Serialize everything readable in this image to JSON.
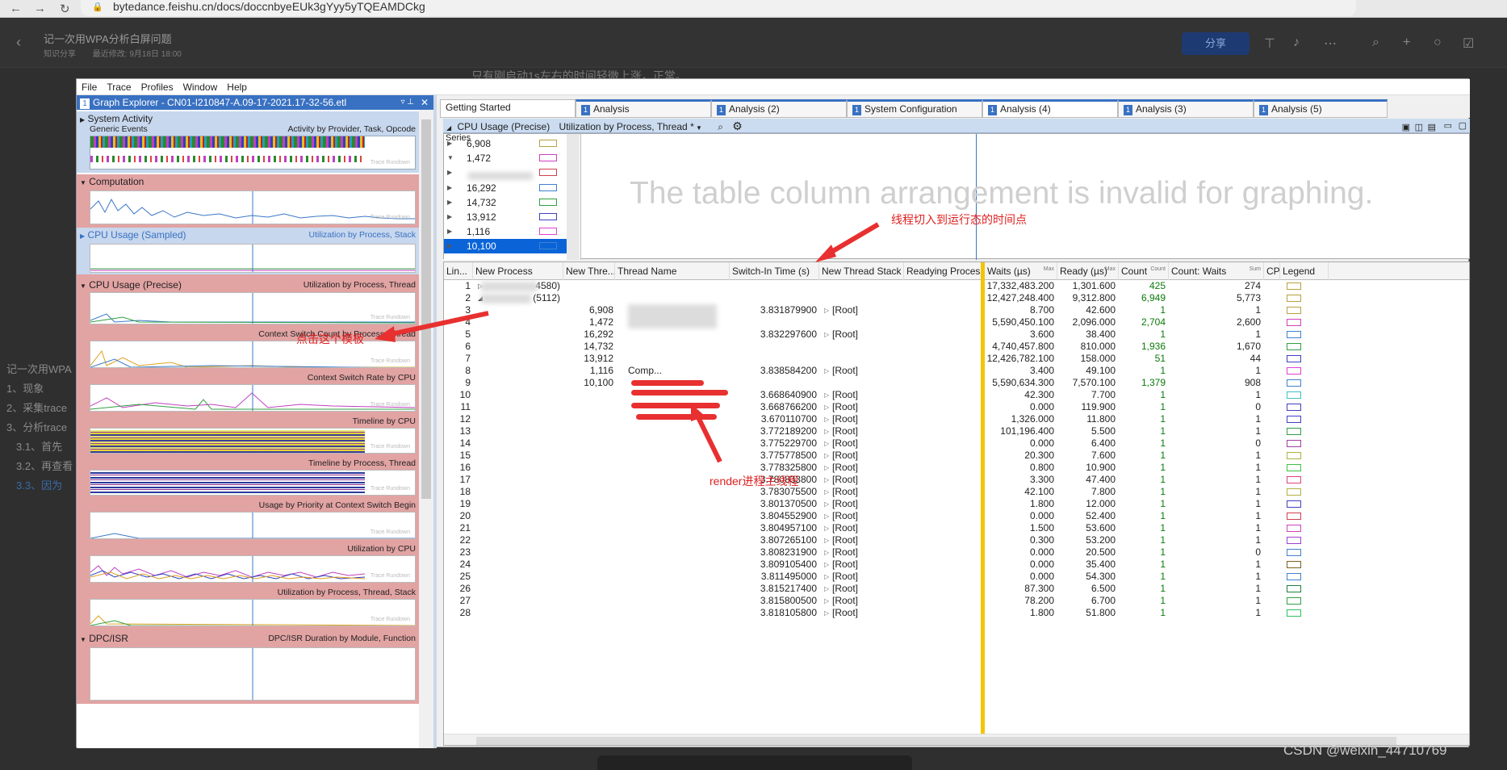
{
  "browser": {
    "url": "bytedance.feishu.cn/docs/doccnbyeEUk3gYyy5yTQEAMDCkg"
  },
  "doc": {
    "title": "记一次用WPA分析白屏问题",
    "meta_tag": "知识分享",
    "meta_updated": "最近修改: 9月18日 18:00",
    "share_label": "分享",
    "sentence": "只有刚启动1s左右的时间轻微上涨，正常。",
    "toc": [
      "记一次用WPA",
      "1、现象",
      "2、采集trace",
      "3、分析trace",
      "3.1、首先",
      "3.2、再查看",
      "3.3、因为"
    ]
  },
  "wpa": {
    "menu": [
      "File",
      "Trace",
      "Profiles",
      "Window",
      "Help"
    ],
    "graph_explorer": {
      "number": "1",
      "title": "Graph Explorer - CN01-I210847-A.09-17-2021.17-32-56.etl",
      "groups": [
        {
          "name": "System Activity",
          "sub": "Generic Events",
          "label": "Activity by Provider, Task, Opcode"
        },
        {
          "name": "Computation",
          "label": ""
        },
        {
          "name": "CPU Usage (Sampled)",
          "label": "Utilization by Process, Stack"
        },
        {
          "name": "CPU Usage (Precise)",
          "label": "Utilization by Process, Thread"
        }
      ],
      "graphs": [
        "Context Switch Count by Process, Thread",
        "Context Switch Rate by CPU",
        "Timeline by CPU",
        "Timeline by Process, Thread",
        "Usage by Priority at Context Switch Begin",
        "Utilization by CPU",
        "Utilization by Process, Thread, Stack"
      ],
      "dpc_group": {
        "name": "DPC/ISR",
        "label": "DPC/ISR Duration by Module, Function"
      },
      "watermark": "Trace Rundown"
    },
    "tabs": [
      {
        "num": "",
        "label": "Getting Started"
      },
      {
        "num": "1",
        "label": "Analysis"
      },
      {
        "num": "1",
        "label": "Analysis (2)"
      },
      {
        "num": "1",
        "label": "System Configuration"
      },
      {
        "num": "1",
        "label": "Analysis (4)"
      },
      {
        "num": "1",
        "label": "Analysis (3)"
      },
      {
        "num": "1",
        "label": "Analysis (5)"
      }
    ],
    "view": {
      "title": "CPU Usage (Precise)",
      "preset": "Utilization by Process, Thread *"
    },
    "series": {
      "header": "Series",
      "rows": [
        {
          "val": "6,908",
          "color": "#b8a040",
          "expanded": false
        },
        {
          "val": "1,472",
          "color": "#d040c0",
          "expanded": true
        },
        {
          "val": "",
          "color": "#d04050",
          "expanded": false
        },
        {
          "val": "16,292",
          "color": "#4080d0",
          "expanded": false
        },
        {
          "val": "14,732",
          "color": "#30a040",
          "expanded": false
        },
        {
          "val": "13,912",
          "color": "#4040c0",
          "expanded": false
        },
        {
          "val": "1,116",
          "color": "#e040d0",
          "expanded": false
        },
        {
          "val": "10,100",
          "color": "#4080d0",
          "expanded": false,
          "selected": true
        }
      ]
    },
    "graph_message": "The table column arrangement is invalid for graphing.",
    "columns": [
      {
        "label": "Lin...",
        "sub": ""
      },
      {
        "label": "New Process",
        "sub": ""
      },
      {
        "label": "New Thre...",
        "sub": ""
      },
      {
        "label": "Thread Name",
        "sub": ""
      },
      {
        "label": "Switch-In Time (s)",
        "sub": ""
      },
      {
        "label": "New Thread Stack",
        "sub": ""
      },
      {
        "label": "Readying Process",
        "sub": ""
      },
      {
        "label": "Waits (µs)",
        "sub": "Max"
      },
      {
        "label": "Ready (µs)",
        "sub": "Max"
      },
      {
        "label": "Count",
        "sub": "Count"
      },
      {
        "label": "Count: Waits",
        "sub": "Sum"
      },
      {
        "label": "CPU",
        "sub": ""
      },
      {
        "label": "Legend",
        "sub": ""
      }
    ],
    "rows": [
      {
        "line": "1",
        "proc": "4580)",
        "thread": "",
        "name": "",
        "switch": "",
        "stack": "",
        "waits": "17,332,483.200",
        "ready": "1,301.600",
        "count": "425",
        "cw": "274",
        "color": "#b8a040"
      },
      {
        "line": "2",
        "proc": "(5112)",
        "thread": "",
        "name": "",
        "switch": "",
        "stack": "",
        "waits": "12,427,248.400",
        "ready": "9,312.800",
        "count": "6,949",
        "cw": "5,773",
        "color": "#b8a040"
      },
      {
        "line": "3",
        "proc": "",
        "thread": "6,908",
        "name": "",
        "switch": "3.831879900",
        "stack": "[Root]",
        "waits": "8.700",
        "ready": "42.600",
        "count": "1",
        "cw": "1",
        "color": "#b8a040"
      },
      {
        "line": "4",
        "proc": "",
        "thread": "1,472",
        "name": "",
        "switch": "",
        "stack": "",
        "waits": "5,590,450.100",
        "ready": "2,096.000",
        "count": "2,704",
        "cw": "2,600",
        "color": "#d040c0"
      },
      {
        "line": "5",
        "proc": "",
        "thread": "16,292",
        "name": "",
        "switch": "3.832297600",
        "stack": "[Root]",
        "waits": "3.600",
        "ready": "38.400",
        "count": "1",
        "cw": "1",
        "color": "#4080d0"
      },
      {
        "line": "6",
        "proc": "",
        "thread": "14,732",
        "name": "",
        "switch": "",
        "stack": "",
        "waits": "4,740,457.800",
        "ready": "810.000",
        "count": "1,936",
        "cw": "1,670",
        "color": "#30a040"
      },
      {
        "line": "7",
        "proc": "",
        "thread": "13,912",
        "name": "",
        "switch": "",
        "stack": "",
        "waits": "12,426,782.100",
        "ready": "158.000",
        "count": "51",
        "cw": "44",
        "color": "#4040c0"
      },
      {
        "line": "8",
        "proc": "",
        "thread": "1,116",
        "name": "Comp...",
        "switch": "3.838584200",
        "stack": "[Root]",
        "waits": "3.400",
        "ready": "49.100",
        "count": "1",
        "cw": "1",
        "color": "#e040d0"
      },
      {
        "line": "9",
        "proc": "",
        "thread": "10,100",
        "name": "",
        "switch": "",
        "stack": "",
        "waits": "5,590,634.300",
        "ready": "7,570.100",
        "count": "1,379",
        "cw": "908",
        "color": "#4080d0"
      },
      {
        "line": "10",
        "proc": "",
        "thread": "",
        "name": "",
        "switch": "3.668640900",
        "stack": "[Root]",
        "waits": "42.300",
        "ready": "7.700",
        "count": "1",
        "cw": "1",
        "color": "#40c0c0"
      },
      {
        "line": "11",
        "proc": "",
        "thread": "",
        "name": "",
        "switch": "3.668766200",
        "stack": "[Root]",
        "waits": "0.000",
        "ready": "119.900",
        "count": "1",
        "cw": "0",
        "color": "#4040c0"
      },
      {
        "line": "12",
        "proc": "",
        "thread": "",
        "name": "",
        "switch": "3.670110700",
        "stack": "[Root]",
        "waits": "1,326.000",
        "ready": "11.800",
        "count": "1",
        "cw": "1",
        "color": "#4040c0"
      },
      {
        "line": "13",
        "proc": "",
        "thread": "",
        "name": "",
        "switch": "3.772189200",
        "stack": "[Root]",
        "waits": "101,196.400",
        "ready": "5.500",
        "count": "1",
        "cw": "1",
        "color": "#30a040"
      },
      {
        "line": "14",
        "proc": "",
        "thread": "",
        "name": "",
        "switch": "3.775229700",
        "stack": "[Root]",
        "waits": "0.000",
        "ready": "6.400",
        "count": "1",
        "cw": "0",
        "color": "#a040a0"
      },
      {
        "line": "15",
        "proc": "",
        "thread": "",
        "name": "",
        "switch": "3.775778500",
        "stack": "[Root]",
        "waits": "20.300",
        "ready": "7.600",
        "count": "1",
        "cw": "1",
        "color": "#b0b040"
      },
      {
        "line": "16",
        "proc": "",
        "thread": "",
        "name": "",
        "switch": "3.778325800",
        "stack": "[Root]",
        "waits": "0.800",
        "ready": "10.900",
        "count": "1",
        "cw": "1",
        "color": "#40c040"
      },
      {
        "line": "17",
        "proc": "",
        "thread": "",
        "name": "",
        "switch": "3.780833800",
        "stack": "[Root]",
        "waits": "3.300",
        "ready": "47.400",
        "count": "1",
        "cw": "1",
        "color": "#e04080"
      },
      {
        "line": "18",
        "proc": "",
        "thread": "",
        "name": "",
        "switch": "3.783075500",
        "stack": "[Root]",
        "waits": "42.100",
        "ready": "7.800",
        "count": "1",
        "cw": "1",
        "color": "#b0b040"
      },
      {
        "line": "19",
        "proc": "",
        "thread": "",
        "name": "",
        "switch": "3.801370500",
        "stack": "[Root]",
        "waits": "1.800",
        "ready": "12.000",
        "count": "1",
        "cw": "1",
        "color": "#4040c0"
      },
      {
        "line": "20",
        "proc": "",
        "thread": "",
        "name": "",
        "switch": "3.804552900",
        "stack": "[Root]",
        "waits": "0.000",
        "ready": "52.400",
        "count": "1",
        "cw": "1",
        "color": "#d04050"
      },
      {
        "line": "21",
        "proc": "",
        "thread": "",
        "name": "",
        "switch": "3.804957100",
        "stack": "[Root]",
        "waits": "1.500",
        "ready": "53.600",
        "count": "1",
        "cw": "1",
        "color": "#d040c0"
      },
      {
        "line": "22",
        "proc": "",
        "thread": "",
        "name": "",
        "switch": "3.807265100",
        "stack": "[Root]",
        "waits": "0.300",
        "ready": "53.200",
        "count": "1",
        "cw": "1",
        "color": "#a040d0"
      },
      {
        "line": "23",
        "proc": "",
        "thread": "",
        "name": "",
        "switch": "3.808231900",
        "stack": "[Root]",
        "waits": "0.000",
        "ready": "20.500",
        "count": "1",
        "cw": "0",
        "color": "#4080d0"
      },
      {
        "line": "24",
        "proc": "",
        "thread": "",
        "name": "",
        "switch": "3.809105400",
        "stack": "[Root]",
        "waits": "0.000",
        "ready": "35.400",
        "count": "1",
        "cw": "1",
        "color": "#806020"
      },
      {
        "line": "25",
        "proc": "",
        "thread": "",
        "name": "",
        "switch": "3.811495000",
        "stack": "[Root]",
        "waits": "0.000",
        "ready": "54.300",
        "count": "1",
        "cw": "1",
        "color": "#4080d0"
      },
      {
        "line": "26",
        "proc": "",
        "thread": "",
        "name": "",
        "switch": "3.815217400",
        "stack": "[Root]",
        "waits": "87.300",
        "ready": "6.500",
        "count": "1",
        "cw": "1",
        "color": "#208040"
      },
      {
        "line": "27",
        "proc": "",
        "thread": "",
        "name": "",
        "switch": "3.815800500",
        "stack": "[Root]",
        "waits": "78.200",
        "ready": "6.700",
        "count": "1",
        "cw": "1",
        "color": "#30a040"
      },
      {
        "line": "28",
        "proc": "",
        "thread": "",
        "name": "",
        "switch": "3.818105800",
        "stack": "[Root]",
        "waits": "1.800",
        "ready": "51.800",
        "count": "1",
        "cw": "1",
        "color": "#30c060"
      }
    ]
  },
  "annotations": {
    "switch_in": "线程切入到运行态的时间点",
    "click_template": "点击这个模板",
    "render_main": "render进程主线程"
  },
  "watermark": "CSDN @weixin_44710769",
  "colors": {
    "accent": "#3971c2",
    "annotation": "#e02020",
    "highlight": "#f2c500",
    "count": "#0a7a0a"
  }
}
